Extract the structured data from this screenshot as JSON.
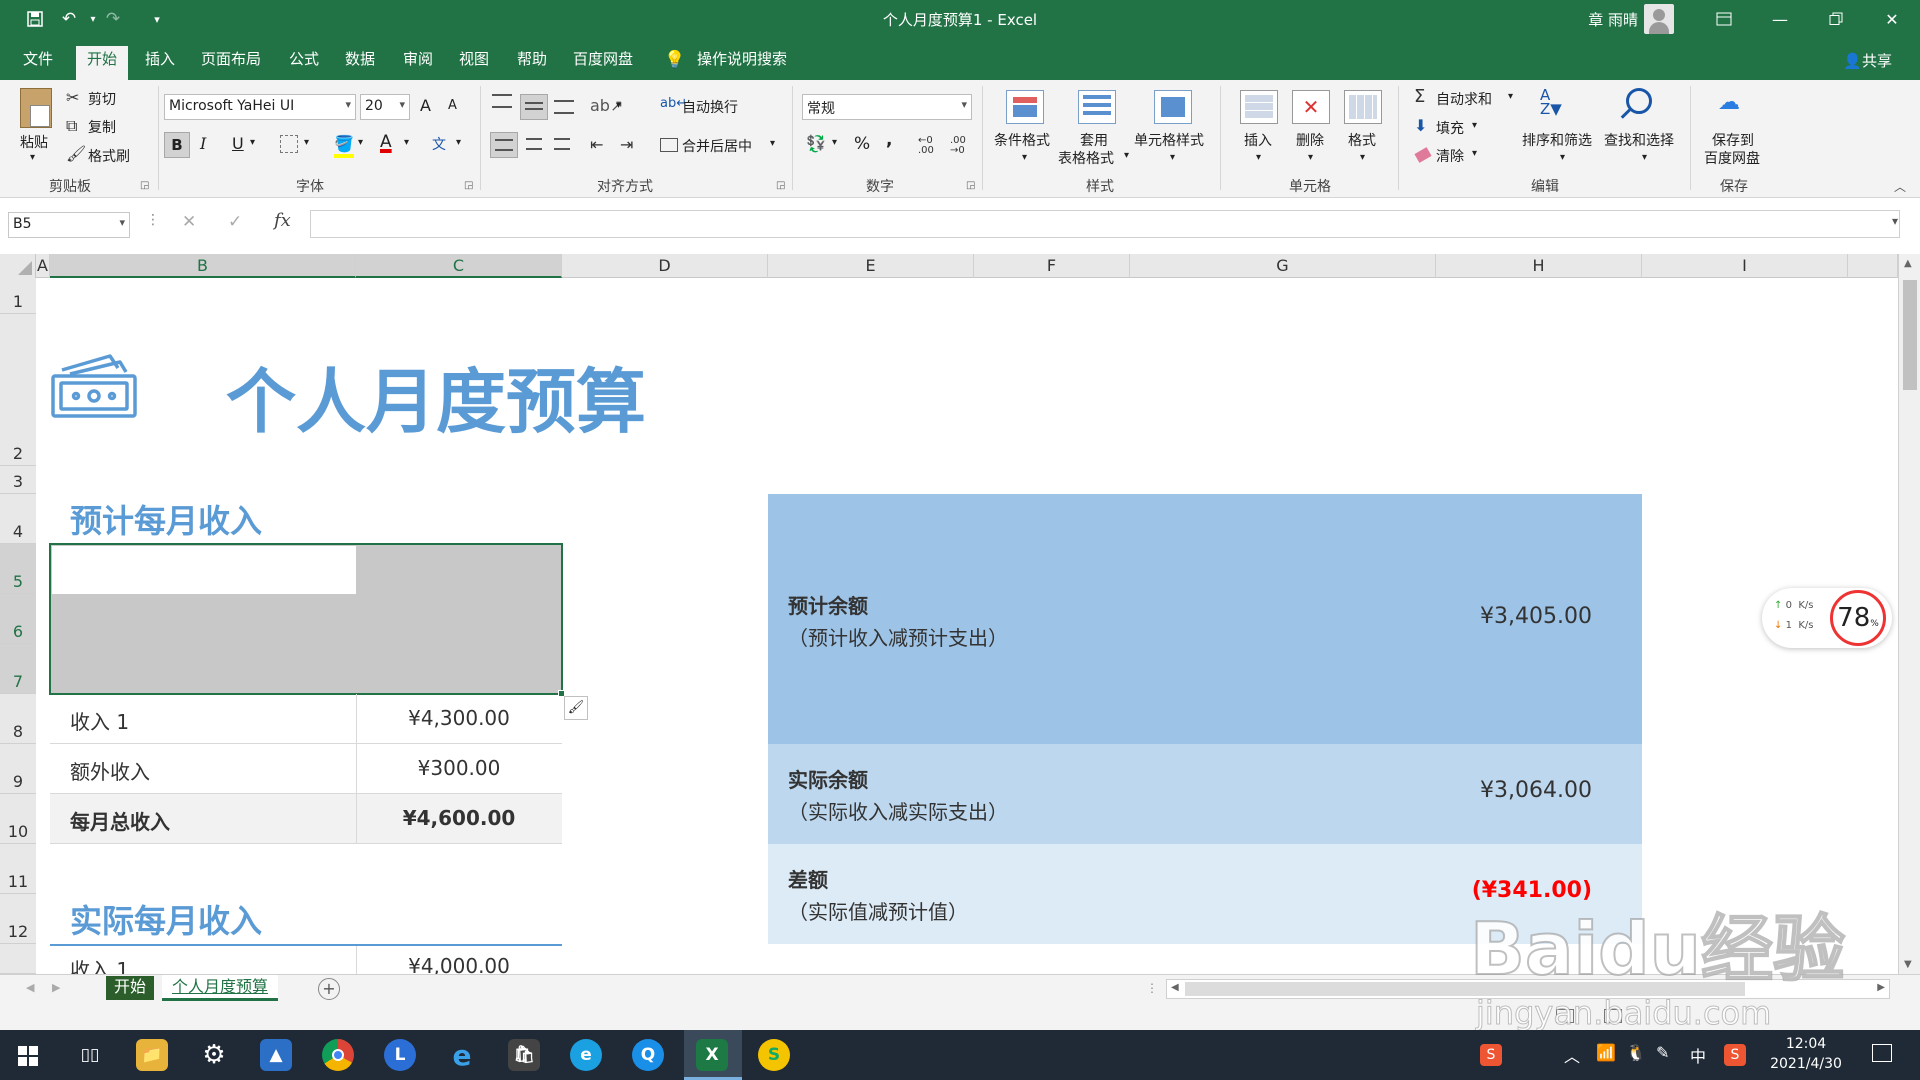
{
  "app": {
    "title": "个人月度预算1 - Excel",
    "user": "章 雨晴",
    "share_label": "共享",
    "qa_icons": [
      "save-icon",
      "undo-icon",
      "redo-icon",
      "customize-icon"
    ]
  },
  "tabs": [
    "文件",
    "开始",
    "插入",
    "页面布局",
    "公式",
    "数据",
    "审阅",
    "视图",
    "帮助",
    "百度网盘"
  ],
  "active_tab": "开始",
  "tell_me": "操作说明搜索",
  "ribbon": {
    "clipboard": {
      "paste": "粘贴",
      "cut": "剪切",
      "copy": "复制",
      "format_painter": "格式刷",
      "label": "剪贴板"
    },
    "font": {
      "family": "Microsoft YaHei UI",
      "size": "20",
      "label": "字体",
      "bold": "B",
      "italic": "I",
      "underline": "U",
      "grow": "A",
      "shrink": "A",
      "font_color_letter": "A"
    },
    "alignment": {
      "wrap": "自动换行",
      "merge": "合并后居中",
      "label": "对齐方式"
    },
    "number": {
      "format": "常规",
      "label": "数字",
      "percent": "%",
      "comma": ","
    },
    "styles": {
      "conditional": "条件格式",
      "table_format_1": "套用",
      "table_format_2": "表格格式",
      "cell_styles": "单元格样式",
      "label": "样式"
    },
    "cells": {
      "insert": "插入",
      "delete": "删除",
      "format": "格式",
      "label": "单元格"
    },
    "editing": {
      "autosum": "自动求和",
      "fill": "填充",
      "clear": "清除",
      "sort": "排序和筛选",
      "find": "查找和选择",
      "label": "编辑"
    },
    "save": {
      "save_1": "保存到",
      "save_2": "百度网盘",
      "label": "保存"
    }
  },
  "formula_bar": {
    "name_box": "B5",
    "fx": "fx",
    "value": ""
  },
  "columns": [
    "A",
    "B",
    "C",
    "D",
    "E",
    "F",
    "G",
    "H",
    "I"
  ],
  "rows": [
    "1",
    "2",
    "3",
    "4",
    "5",
    "6",
    "7",
    "8",
    "9",
    "10",
    "11",
    "12"
  ],
  "sheet": {
    "title": "个人月度预算",
    "projected_income_heading": "预计每月收入",
    "actual_income_heading": "实际每月收入",
    "income_rows": [
      {
        "label": "收入 1",
        "value": "¥4,300.00"
      },
      {
        "label": "额外收入",
        "value": "¥300.00"
      },
      {
        "label": "每月总收入",
        "value": "¥4,600.00"
      }
    ],
    "actual_partial_row": {
      "label": "收入 1",
      "value": "¥4,000.00"
    },
    "summary": [
      {
        "title": "预计余额",
        "subtitle": "（预计收入减预计支出）",
        "value": "¥3,405.00",
        "bg": "#9dc3e6"
      },
      {
        "title": "实际余额",
        "subtitle": "（实际收入减实际支出）",
        "value": "¥3,064.00",
        "bg": "#bdd7ee"
      },
      {
        "title": "差额",
        "subtitle": "（实际值减预计值）",
        "value": "(¥341.00)",
        "bg": "#ddebf7"
      }
    ],
    "negative_color": "#ff0000"
  },
  "sheet_tabs": [
    {
      "label": "开始",
      "active": false
    },
    {
      "label": "个人月度预算",
      "active": true
    }
  ],
  "net_widget": {
    "up": "0",
    "down": "1",
    "unit": "K/s",
    "percent": "78",
    "percent_sign": "%"
  },
  "taskbar": {
    "time": "12:04",
    "date": "2021/4/30",
    "ime": "中"
  },
  "watermark": {
    "line1": "Baidu经验",
    "line2": "jingyan.baidu.com"
  }
}
